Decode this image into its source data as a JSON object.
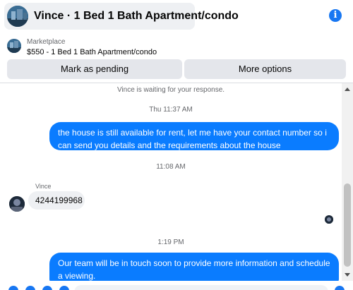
{
  "header": {
    "title": "Vince · 1 Bed 1 Bath Apartment/condo"
  },
  "listing": {
    "source": "Marketplace",
    "title": "$550 - 1 Bed 1 Bath Apartment/condo"
  },
  "actions": {
    "pending_label": "Mark as pending",
    "more_label": "More options"
  },
  "chat": {
    "waiting_notice": "Vince is waiting for your response.",
    "timestamps": [
      "Thu 11:37 AM",
      "11:08 AM",
      "1:19 PM"
    ],
    "messages": [
      {
        "direction": "outgoing",
        "text": "the house is still available for rent, let me have your contact number so i can send you details and the requirements about the house"
      },
      {
        "direction": "incoming",
        "sender": "Vince",
        "text": "4244199968"
      },
      {
        "direction": "outgoing",
        "text": "Our team will be in touch soon to provide more information and schedule a viewing."
      }
    ]
  },
  "colors": {
    "accent": "#1877f2",
    "outgoing_bubble": "#0a7cff",
    "incoming_bubble": "#eef0f3",
    "button_bg": "#e4e6eb"
  },
  "icons": {
    "info": "info-icon",
    "scroll_up": "chevron-up-icon",
    "scroll_down": "chevron-down-icon"
  }
}
